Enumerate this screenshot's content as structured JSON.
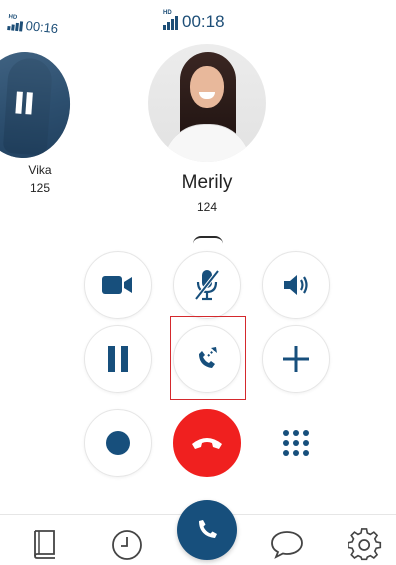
{
  "held_call": {
    "hd_label": "HD",
    "duration": "00:16",
    "name": "Vika",
    "extension": "125"
  },
  "active_call": {
    "hd_label": "HD",
    "duration": "00:18",
    "name": "Merily",
    "extension": "124"
  },
  "controls": [
    {
      "name": "video",
      "icon": "video-camera-icon"
    },
    {
      "name": "mute",
      "icon": "microphone-muted-icon"
    },
    {
      "name": "speaker",
      "icon": "speaker-icon"
    },
    {
      "name": "hold",
      "icon": "pause-icon"
    },
    {
      "name": "transfer",
      "icon": "phone-transfer-icon"
    },
    {
      "name": "add-call",
      "icon": "plus-icon"
    },
    {
      "name": "record",
      "icon": "record-dot-icon"
    },
    {
      "name": "end-call",
      "icon": "hang-up-icon"
    },
    {
      "name": "keypad",
      "icon": "dialpad-icon"
    }
  ],
  "colors": {
    "accent": "#174f7c",
    "end_call": "#f0201f",
    "highlight": "#d4292d"
  },
  "nav": [
    {
      "name": "contacts",
      "icon": "book-icon"
    },
    {
      "name": "recents",
      "icon": "clock-icon"
    },
    {
      "name": "dialer",
      "icon": "phone-icon"
    },
    {
      "name": "chat",
      "icon": "chat-bubble-icon"
    },
    {
      "name": "settings",
      "icon": "gear-icon"
    }
  ]
}
